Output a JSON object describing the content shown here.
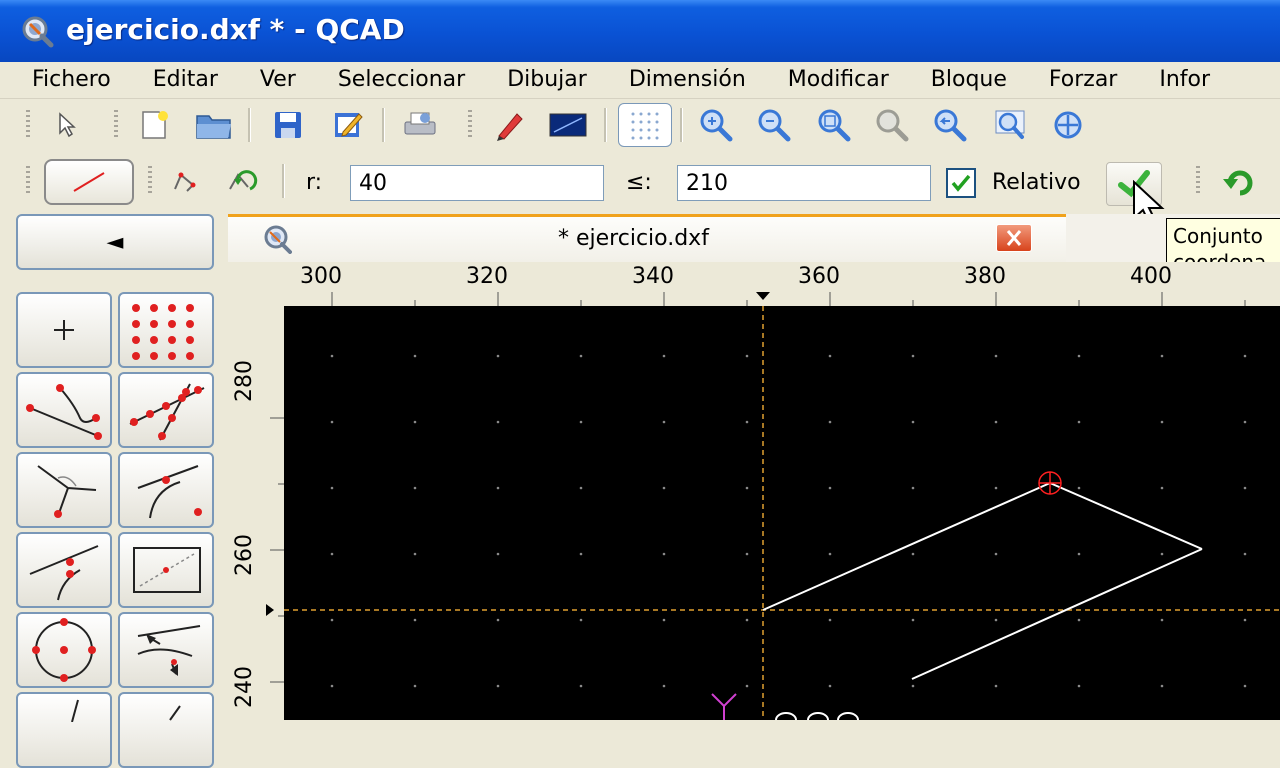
{
  "window": {
    "title": "ejercicio.dxf * - QCAD"
  },
  "menu": [
    "Fichero",
    "Editar",
    "Ver",
    "Seleccionar",
    "Dibujar",
    "Dimensión",
    "Modificar",
    "Bloque",
    "Forzar",
    "Infor"
  ],
  "toolbar1": {
    "icons": [
      "select-arrow-icon",
      "new-file-icon",
      "open-folder-icon",
      "save-icon",
      "save-as-icon",
      "print-preview-icon",
      "pen-icon",
      "color-swatch-icon",
      "grid-icon",
      "zoom-in-icon",
      "zoom-out-icon",
      "zoom-auto-icon",
      "zoom-window-icon",
      "zoom-previous-icon",
      "zoom-redraw-icon",
      "pan-icon"
    ]
  },
  "toolbar2": {
    "r_label": "r:",
    "r_value": "40",
    "angle_label": "≤:",
    "angle_value": "210",
    "relative_label": "Relativo",
    "relative_checked": true
  },
  "tooltip": {
    "line1": "Conjunto",
    "line2": "coordena"
  },
  "document": {
    "tab_title": "* ejercicio.dxf"
  },
  "left_panel": {
    "back_label": "◄",
    "tools": [
      "point-tool",
      "point-array-tool",
      "line-tangent-tool",
      "line-multi-points-tool",
      "line-angle-bisector-tool",
      "line-tangent-arc-tool",
      "line-relative-angle-tool",
      "rectangle-tool",
      "circle-tool",
      "parallel-line-tool",
      "line-vertical-tool",
      "line-free-tool"
    ]
  },
  "rulers": {
    "x": [
      "300",
      "320",
      "340",
      "360",
      "380",
      "400"
    ],
    "y": [
      "280",
      "260",
      "240"
    ]
  },
  "colors": {
    "titlebar": "#0a52d4",
    "canvas_bg": "#000000",
    "crosshair": "#e0a030",
    "entity": "#ffffff",
    "snap_marker": "#ff2020",
    "origin_axis": "#d040d0"
  }
}
